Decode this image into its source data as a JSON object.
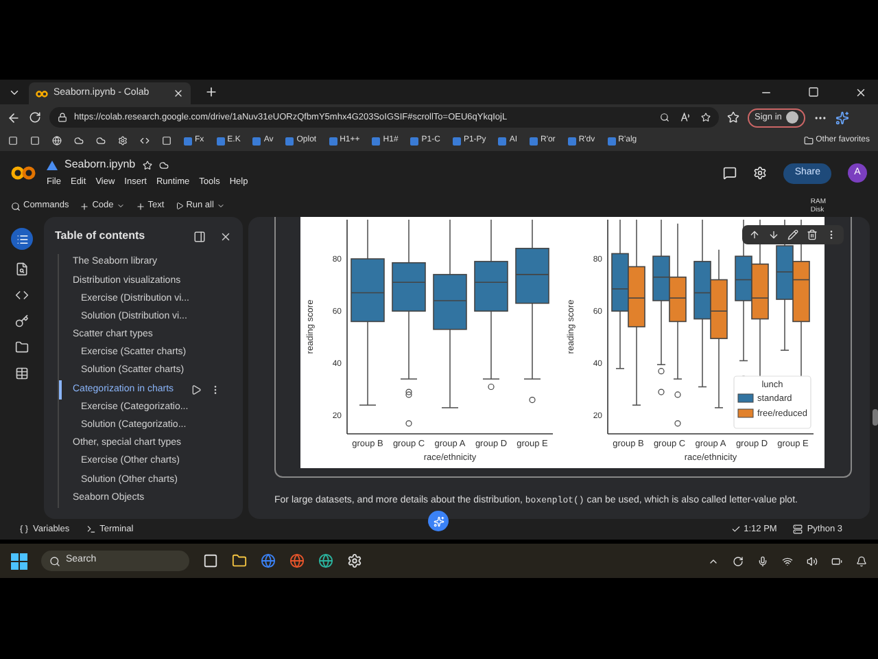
{
  "browser": {
    "tabs": [
      {
        "title": "Seaborn.ipynb - Colab",
        "selected": true
      }
    ],
    "url": "https://colab.research.google.com/drive/1aNuv31eUORzQfbmY5mhx4G203SoIGSIF#scrollTo=OEU6qYkqIojL",
    "sign_in": "Sign in",
    "bookmarks": [
      "Fx",
      "E.K",
      "Av",
      "Oplot",
      "H1++",
      "H1#",
      "P1-C",
      "P1-Py",
      "AI",
      "R'or",
      "R'dv",
      "R'alg"
    ],
    "other_favorites": "Other favorites"
  },
  "colab": {
    "title": "Seaborn.ipynb",
    "menu": [
      "File",
      "Edit",
      "View",
      "Insert",
      "Runtime",
      "Tools",
      "Help"
    ],
    "share": "Share",
    "avatar": "A",
    "toolbar": [
      "Commands",
      "Code",
      "Text",
      "Run all"
    ],
    "ram": "RAM",
    "disk": "Disk"
  },
  "toc": {
    "title": "Table of contents",
    "items": [
      {
        "label": "The Seaborn library",
        "selected": false
      },
      {
        "label": "Distribution visualizations",
        "selected": false,
        "children": [
          {
            "label": "Exercise (Distribution vi...",
            "selected": false
          },
          {
            "label": "Solution (Distribution vi...",
            "selected": false
          }
        ]
      },
      {
        "label": "Scatter chart types",
        "selected": false,
        "children": [
          {
            "label": "Exercise (Scatter charts)",
            "selected": false
          },
          {
            "label": "Solution (Scatter charts)",
            "selected": false
          }
        ]
      },
      {
        "label": "Categorization in charts",
        "selected": true,
        "children": [
          {
            "label": "Exercise (Categorizatio...",
            "selected": false
          },
          {
            "label": "Solution (Categorizatio...",
            "selected": false
          }
        ]
      },
      {
        "label": "Other, special chart types",
        "selected": false,
        "children": [
          {
            "label": "Exercise (Other charts)",
            "selected": false
          },
          {
            "label": "Solution (Other charts)",
            "selected": false
          }
        ]
      },
      {
        "label": "Seaborn Objects",
        "selected": false
      }
    ]
  },
  "charts": [
    {
      "xlabel": "race/ethnicity",
      "ylabel": "reading score",
      "categories": [
        "group B",
        "group C",
        "group A",
        "group D",
        "group E"
      ],
      "yticks": [
        "80",
        "60",
        "40",
        "20"
      ]
    },
    {
      "xlabel": "race/ethnicity",
      "ylabel": "reading score",
      "categories": [
        "group B",
        "group C",
        "group A",
        "group D",
        "group E"
      ],
      "yticks": [
        "80",
        "60",
        "40",
        "20"
      ],
      "legend": {
        "title": "lunch",
        "items": [
          {
            "label": "standard",
            "color": "#3274a1"
          },
          {
            "label": "free/reduced",
            "color": "#e1812c"
          }
        ]
      }
    }
  ],
  "paragraph": {
    "before": "For large datasets, and more details about the distribution, ",
    "code": "boxenplot()",
    "after": " can be used, which is also called letter-value plot."
  },
  "status_bar": {
    "variables": "Variables",
    "terminal": "Terminal",
    "time": "1:12 PM",
    "runtime": "Python 3"
  },
  "taskbar": {
    "search": "Search"
  }
}
